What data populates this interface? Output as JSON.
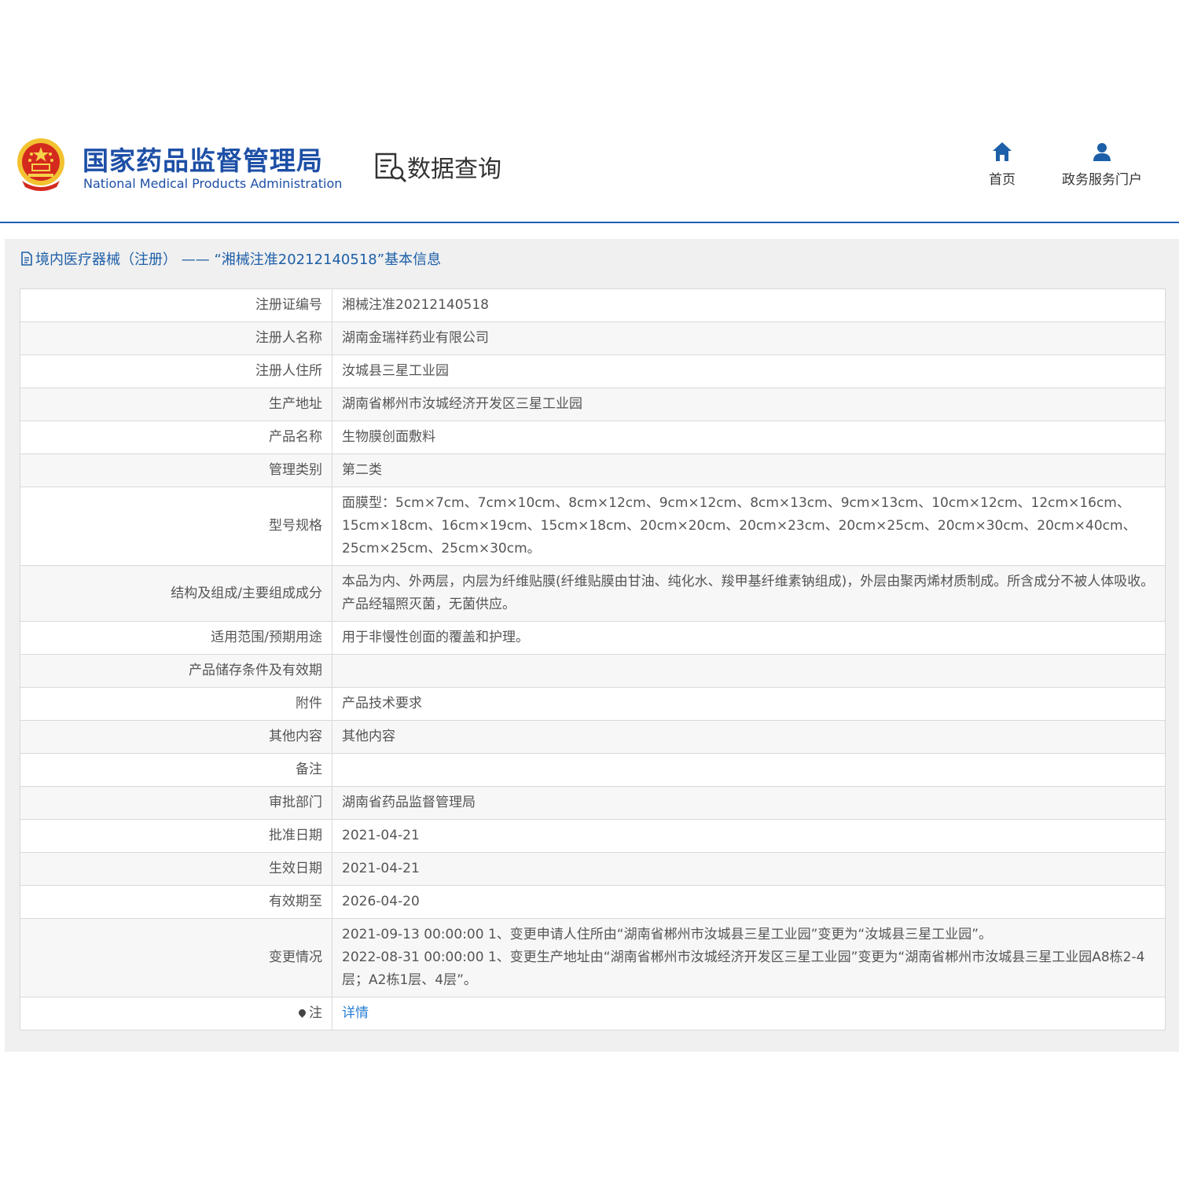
{
  "header": {
    "logo_cn": "国家药品监督管理局",
    "logo_en": "National Medical Products Administration",
    "section_label": "数据查询",
    "nav": [
      {
        "label": "首页",
        "icon": "home-icon"
      },
      {
        "label": "政务服务门户",
        "icon": "user-icon"
      }
    ]
  },
  "breadcrumb": "境内医疗器械（注册） —— “湘械注准20212140518”基本信息",
  "rows": [
    {
      "key": "注册证编号",
      "value": "湘械注准20212140518"
    },
    {
      "key": "注册人名称",
      "value": "湖南金瑞祥药业有限公司"
    },
    {
      "key": "注册人住所",
      "value": "汝城县三星工业园"
    },
    {
      "key": "生产地址",
      "value": "湖南省郴州市汝城经济开发区三星工业园"
    },
    {
      "key": "产品名称",
      "value": "生物膜创面敷料"
    },
    {
      "key": "管理类别",
      "value": "第二类"
    },
    {
      "key": "型号规格",
      "value": "面膜型：5cm×7cm、7cm×10cm、8cm×12cm、9cm×12cm、8cm×13cm、9cm×13cm、10cm×12cm、12cm×16cm、15cm×18cm、16cm×19cm、15cm×18cm、20cm×20cm、20cm×23cm、20cm×25cm、20cm×30cm、20cm×40cm、25cm×25cm、25cm×30cm。"
    },
    {
      "key": "结构及组成/主要组成成分",
      "value": "本品为内、外两层，内层为纤维贴膜(纤维贴膜由甘油、纯化水、羧甲基纤维素钠组成)，外层由聚丙烯材质制成。所含成分不被人体吸收。产品经辐照灭菌，无菌供应。"
    },
    {
      "key": "适用范围/预期用途",
      "value": "用于非慢性创面的覆盖和护理。"
    },
    {
      "key": "产品储存条件及有效期",
      "value": ""
    },
    {
      "key": "附件",
      "value": "产品技术要求"
    },
    {
      "key": "其他内容",
      "value": "其他内容"
    },
    {
      "key": "备注",
      "value": ""
    },
    {
      "key": "审批部门",
      "value": "湖南省药品监督管理局"
    },
    {
      "key": "批准日期",
      "value": "2021-04-21"
    },
    {
      "key": "生效日期",
      "value": "2021-04-21"
    },
    {
      "key": "有效期至",
      "value": "2026-04-20"
    },
    {
      "key": "变更情况",
      "lines": [
        "2021-09-13 00:00:00 1、变更申请人住所由“湖南省郴州市汝城县三星工业园”变更为“汝城县三星工业园”。",
        "2022-08-31 00:00:00 1、变更生产地址由“湖南省郴州市汝城经济开发区三星工业园”变更为“湖南省郴州市汝城县三星工业园A8栋2-4层；A2栋1层、4层”。"
      ]
    },
    {
      "key": "注",
      "value": "详情",
      "link": true
    }
  ],
  "colors": {
    "brand": "#1d4fa6",
    "link": "#2a7fd4",
    "accent_red": "#d42a1e"
  }
}
